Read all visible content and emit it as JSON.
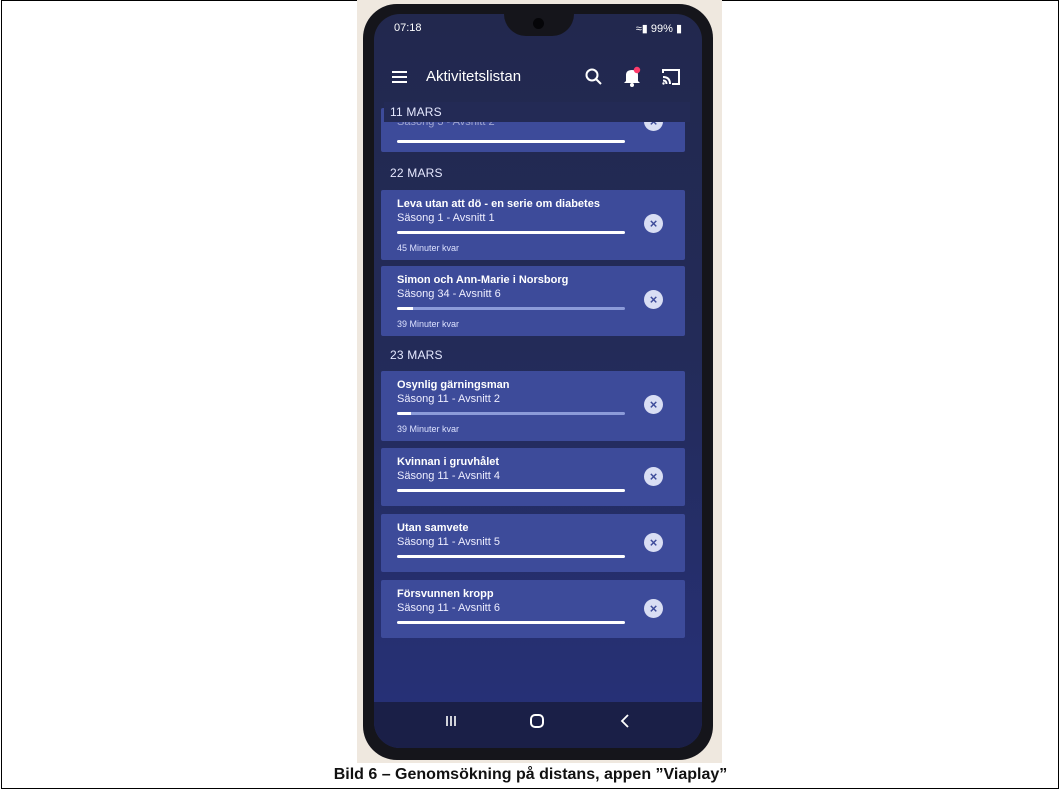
{
  "caption": "Bild 6 – Genomsökning på distans, appen ”Viaplay”",
  "status": {
    "time": "07:18",
    "battery": "99%"
  },
  "appbar": {
    "title": "Aktivitetslistan"
  },
  "colors": {
    "accent": "#3d4b9a",
    "notification_dot": "#ff3b6b"
  },
  "groups": [
    {
      "date": "11 MARS",
      "items": [
        {
          "title": "",
          "subtitle": "Säsong 3 - Avsnitt 2",
          "progress": 1.0,
          "remaining": ""
        }
      ]
    },
    {
      "date": "22 MARS",
      "items": [
        {
          "title": "Leva utan att dö - en serie om diabetes",
          "subtitle": "Säsong 1 - Avsnitt 1",
          "progress": 1.0,
          "remaining": "45 Minuter kvar"
        },
        {
          "title": "Simon och Ann-Marie i Norsborg",
          "subtitle": "Säsong 34 - Avsnitt 6",
          "progress": 0.07,
          "remaining": "39 Minuter kvar"
        }
      ]
    },
    {
      "date": "23 MARS",
      "items": [
        {
          "title": "Osynlig gärningsman",
          "subtitle": "Säsong 11 - Avsnitt 2",
          "progress": 0.06,
          "remaining": "39 Minuter kvar"
        },
        {
          "title": "Kvinnan i gruvhålet",
          "subtitle": "Säsong 11 - Avsnitt 4",
          "progress": 1.0,
          "remaining": ""
        },
        {
          "title": "Utan samvete",
          "subtitle": "Säsong 11 - Avsnitt 5",
          "progress": 1.0,
          "remaining": ""
        },
        {
          "title": "Försvunnen kropp",
          "subtitle": "Säsong 11 - Avsnitt 6",
          "progress": 1.0,
          "remaining": ""
        }
      ]
    }
  ]
}
